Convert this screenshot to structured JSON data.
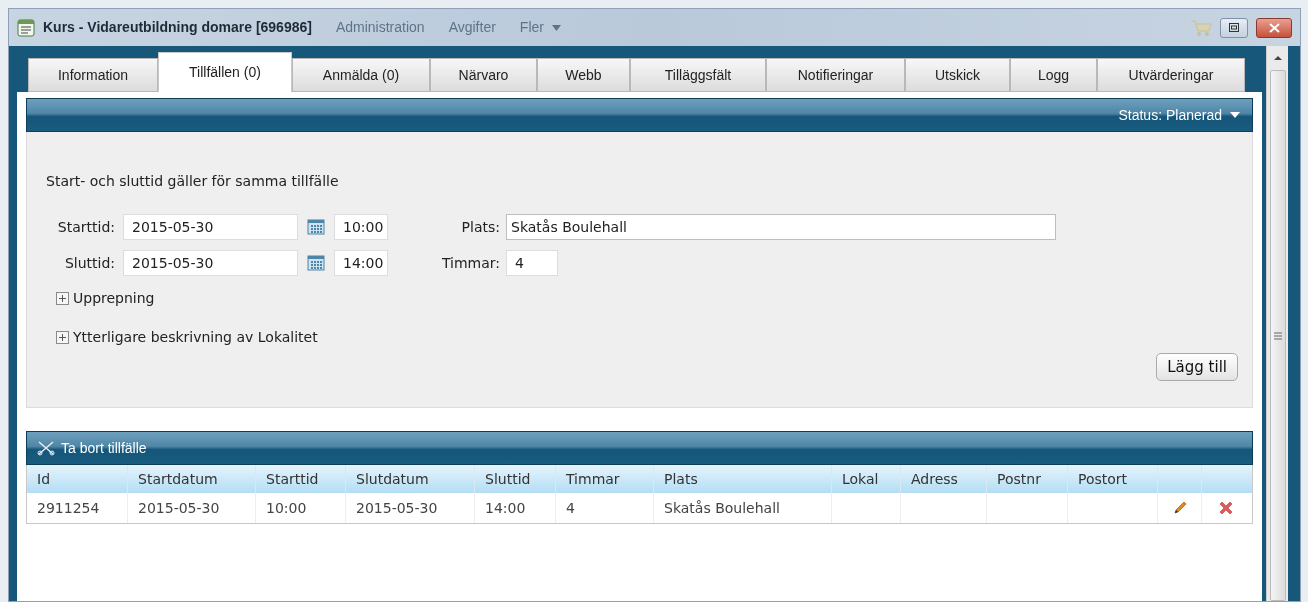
{
  "window": {
    "title": "Kurs - Vidareutbildning domare [696986]",
    "background_menu": [
      "Administration",
      "Avgifter",
      "Fler"
    ]
  },
  "tabs": [
    {
      "label": "Information",
      "selected": false
    },
    {
      "label": "Tillfällen (0)",
      "selected": true
    },
    {
      "label": "Anmälda (0)",
      "selected": false
    },
    {
      "label": "Närvaro",
      "selected": false
    },
    {
      "label": "Webb",
      "selected": false
    },
    {
      "label": "Tilläggsfält",
      "selected": false
    },
    {
      "label": "Notifieringar",
      "selected": false
    },
    {
      "label": "Utskick",
      "selected": false
    },
    {
      "label": "Logg",
      "selected": false
    },
    {
      "label": "Utvärderingar",
      "selected": false
    }
  ],
  "header": {
    "status_label": "Status:",
    "status_value": "Planerad"
  },
  "form": {
    "note": "Start- och sluttid gäller för samma tillfälle",
    "start": {
      "label": "Starttid:",
      "date": "2015-05-30",
      "time": "10:00"
    },
    "end": {
      "label": "Sluttid:",
      "date": "2015-05-30",
      "time": "14:00"
    },
    "place": {
      "label": "Plats:",
      "value": "Skatås Boulehall"
    },
    "hours": {
      "label": "Timmar:",
      "value": "4"
    },
    "expanders": [
      {
        "label": "Upprepning",
        "expanded": false
      },
      {
        "label": "Ytterligare beskrivning av Lokalitet",
        "expanded": false
      }
    ],
    "add_button": "Lägg till"
  },
  "table": {
    "toolbar_button": "Ta bort tillfälle",
    "columns": [
      "Id",
      "Startdatum",
      "Starttid",
      "Slutdatum",
      "Sluttid",
      "Timmar",
      "Plats",
      "Lokal",
      "Adress",
      "Postnr",
      "Postort"
    ],
    "rows": [
      {
        "cells": [
          "2911254",
          "2015-05-30",
          "10:00",
          "2015-05-30",
          "14:00",
          "4",
          "Skatås Boulehall",
          "",
          "",
          "",
          ""
        ]
      }
    ]
  }
}
